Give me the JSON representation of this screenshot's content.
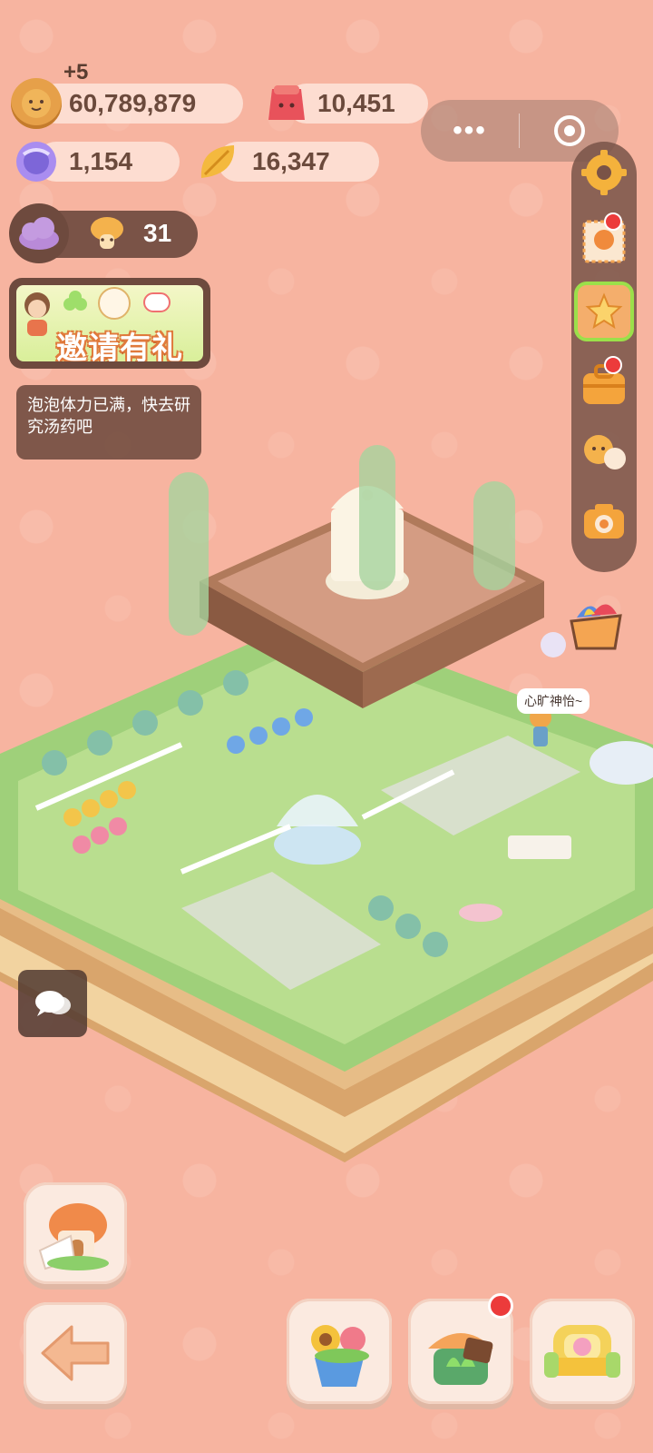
{
  "hud": {
    "gain_popup": "+5",
    "cookies": "60,789,879",
    "gems": "10,451",
    "candy": "1,154",
    "leaves": "16,347",
    "energy_count": "31"
  },
  "invite": {
    "label": "邀请有礼"
  },
  "tip": {
    "text": "泡泡体力已满，快去研究汤药吧"
  },
  "npc": {
    "speech": "心旷神怡~"
  },
  "capsule": {
    "dots": "•••"
  },
  "colors": {
    "accent": "#e07a3c",
    "badge": "#ec3b3b",
    "background": "#f7b4a0"
  },
  "icons": {
    "cookie": "cookie-icon",
    "gem": "red-gem-icon",
    "candy": "candy-icon",
    "leaf": "leaf-icon",
    "settings": "gear-icon",
    "camera": "camera-icon",
    "back": "arrow-left-icon",
    "chat": "chat-icon"
  }
}
